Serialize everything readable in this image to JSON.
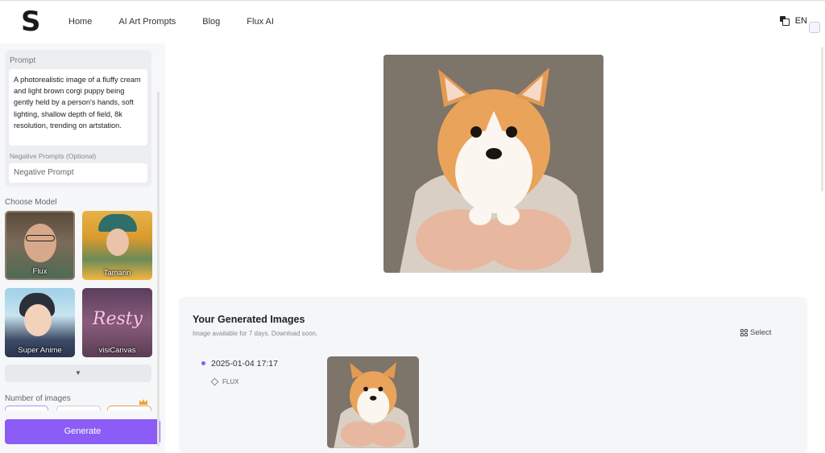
{
  "header": {
    "logo_text": "S",
    "nav": [
      "Home",
      "AI Art Prompts",
      "Blog",
      "Flux AI"
    ],
    "language": "EN"
  },
  "sidebar": {
    "prompt_label": "Prompt",
    "prompt_value": "A photorealistic image of a fluffy cream and light brown corgi puppy being gently held by a person's hands, soft lighting, shallow depth of field, 8k resolution, trending on artstation.",
    "negative_label": "Negative Prompts  (Optional)",
    "negative_placeholder": "Negative Prompt",
    "choose_model_label": "Choose Model",
    "models": [
      "Flux",
      "Tamarin",
      "Super Anime",
      "visiCanvas"
    ],
    "expand_icon": "chevron-down-icon",
    "number_of_images_label": "Number of images",
    "generate_label": "Generate"
  },
  "main": {
    "hero_image": "corgi-puppy-in-hands",
    "generated": {
      "title": "Your Generated Images",
      "subtitle": "Image available for 7 days. Download soon.",
      "select_label": "Select",
      "entries": [
        {
          "date": "2025-01-04 17:17",
          "model": "FLUX",
          "image": "corgi-puppy-in-hands"
        }
      ]
    }
  },
  "colors": {
    "accent": "#8b5cf6",
    "sidebar_bg": "#f6f7f9",
    "panel_bg": "#f5f6f8"
  }
}
